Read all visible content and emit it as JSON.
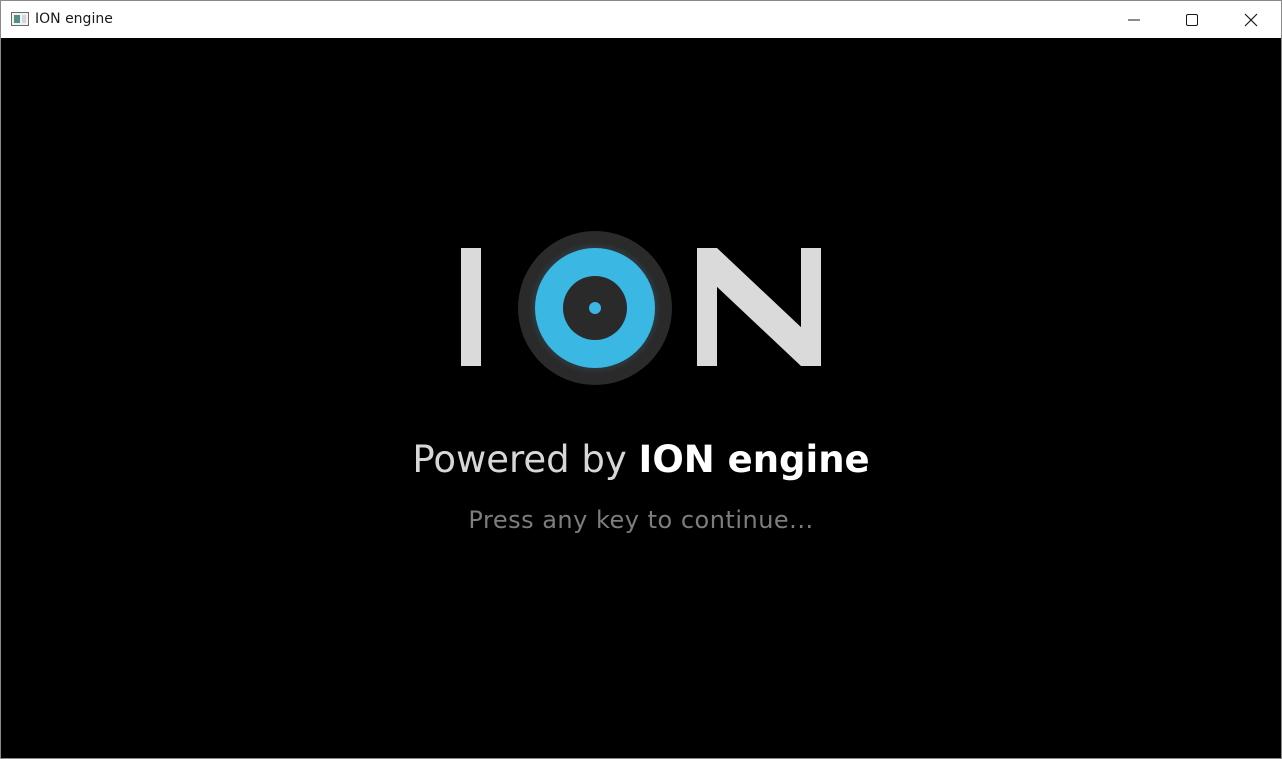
{
  "window": {
    "title": "ION engine",
    "controls": {
      "minimize_icon": "minimize-icon",
      "maximize_icon": "maximize-icon",
      "close_icon": "close-icon"
    }
  },
  "splash": {
    "logo_text": "ION",
    "powered_prefix": "Powered by",
    "powered_brand": "ION engine",
    "prompt": "Press any key to continue..."
  },
  "colors": {
    "accent": "#3ab7e3",
    "background": "#000000",
    "logo_letters": "#dadada",
    "ring": "#2a2a2a"
  }
}
